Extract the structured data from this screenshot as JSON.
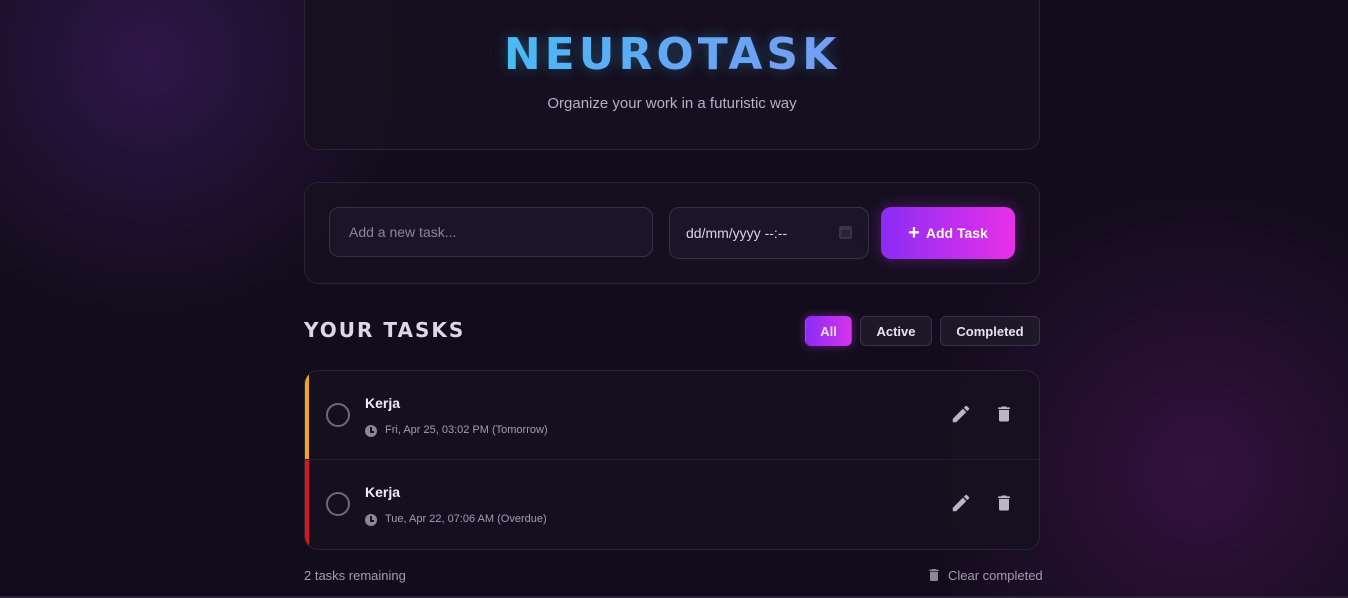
{
  "header": {
    "title": "NEUROTASK",
    "subtitle": "Organize your work in a futuristic way"
  },
  "form": {
    "task_placeholder": "Add a new task...",
    "date_placeholder": "dd/mm/yyyy --:--",
    "add_label": "Add Task",
    "add_icon": "plus-icon"
  },
  "tasks_section": {
    "heading": "YOUR TASKS",
    "filters": [
      "All",
      "Active",
      "Completed"
    ],
    "active_filter": "All"
  },
  "tasks": [
    {
      "title": "Kerja",
      "due": "Fri, Apr 25, 03:02 PM (Tomorrow)",
      "accent_color": "#f0a818",
      "completed": false
    },
    {
      "title": "Kerja",
      "due": "Tue, Apr 22, 07:06 AM (Overdue)",
      "accent_color": "#d8161c",
      "completed": false
    }
  ],
  "footer": {
    "remaining": "2 tasks remaining",
    "clear_label": "Clear completed"
  },
  "colors": {
    "background": "#120d1c",
    "accent_gradient_start": "#8b2cf5",
    "accent_gradient_end": "#e830e8",
    "title_cyan": "#2bd7f3"
  }
}
